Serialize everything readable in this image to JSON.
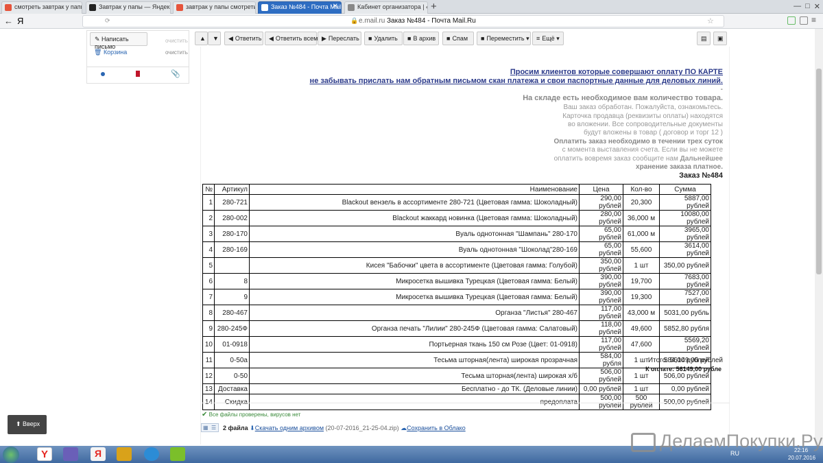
{
  "tabs": [
    {
      "label": "смотреть завтрак у папы н",
      "color": "#e6543c"
    },
    {
      "label": "Завтрак у папы — Яндекс.В",
      "color": "#222222"
    },
    {
      "label": "завтрак у папы смотреть о",
      "color": "#e6543c"
    },
    {
      "label": "Заказ №484 - Почта Mail",
      "color": "#1a5fb4"
    },
    {
      "label": "Кабинет организатора | «Д",
      "color": "#888888"
    }
  ],
  "window": {
    "minimize": "—",
    "restore": "□",
    "close": "✕",
    "new_tab": "+"
  },
  "addressbar": {
    "back": "←",
    "logo": "Я",
    "domain": "e.mail.ru",
    "title": "Заказ №484 - Почта Mail.Ru"
  },
  "sidebar": {
    "compose": "Написать письмо",
    "clear_top": "очистить",
    "trash": "Корзина",
    "clear": "очистить"
  },
  "toolbar": {
    "reply": "Ответить",
    "reply_all": "Ответить всем",
    "forward": "Переслать",
    "delete": "Удалить",
    "archive": "В архив",
    "spam": "Спам",
    "move": "Переместить",
    "more": "Ещё"
  },
  "letter": {
    "notice1": "Просим клиентов которые совершают оплату ПО КАРТЕ",
    "notice2": "не забывать прислать нам обратным письмом скан платежа и свои паспортные данные для деловых линий.",
    "dash": "-",
    "stock": "На складе есть необходимое вам количество товара.",
    "l1": "Ваш заказ обработан. Пожалуйста, ознакомьтесь.",
    "l2": "Карточка продавца (реквизиты оплаты) находятся",
    "l3": "во вложении. Все сопроводительные документы",
    "l4": "будут вложены в товар ( договор и торг 12 )",
    "l5": "Оплатить заказ необходимо в течении трех суток",
    "l6": "с момента выставления счета. Если вы не можете",
    "l7a": "оплатить вовремя заказ сообщите нам ",
    "l7b": "Дальнейшее",
    "l8": "хранение заказа платное.",
    "order_title": "Заказ №484",
    "headers": [
      "№",
      "Артикул",
      "Наименование",
      "Цена",
      "Кол-во",
      "Сумма"
    ],
    "rows": [
      [
        "1",
        "280-721",
        "Blackout вензель в ассортименте 280-721 (Цветовая гамма: Шоколадный)",
        "290,00 рублей",
        "20,300",
        "5887,00 рублей"
      ],
      [
        "2",
        "280-002",
        "Blackout жаккард новинка (Цветовая гамма: Шоколадный)",
        "280,00 рублей",
        "36,000 м",
        "10080,00 рублей"
      ],
      [
        "3",
        "280-170",
        "Вуаль однотонная \"Шампань\" 280-170",
        "65,00 рублей",
        "61,000 м",
        "3965,00 рублей"
      ],
      [
        "4",
        "280-169",
        "Вуаль однотонная \"Шоколад\"280-169",
        "65,00 рублей",
        "55,600",
        "3614,00 рублей"
      ],
      [
        "5",
        "",
        "Кисея \"Бабочки\" цвета в ассортименте (Цветовая гамма: Голубой)",
        "350,00 рублей",
        "1 шт",
        "350,00 рублей"
      ],
      [
        "6",
        "8",
        "Микросетка вышивка Турецкая (Цветовая гамма: Белый)",
        "390,00 рублей",
        "19,700",
        "7683,00 рублей"
      ],
      [
        "7",
        "9",
        "Микросетка вышивка Турецкая (Цветовая гамма: Белый)",
        "390,00 рублей",
        "19,300",
        "7527,00 рублей"
      ],
      [
        "8",
        "280-467",
        "Органза \"Листья\" 280-467",
        "117,00 рублей",
        "43,000 м",
        "5031,00 рубль"
      ],
      [
        "9",
        "280-245Ф",
        "Органза печать \"Лилии\" 280-245Ф (Цветовая гамма: Салатовый)",
        "118,00 рублей",
        "49,600",
        "5852,80 рубля"
      ],
      [
        "10",
        "01-0918",
        "Портьерная ткань 150 см Розе (Цвет: 01-0918)",
        "117,00 рублей",
        "47,600",
        "5569,20 рублей"
      ],
      [
        "11",
        "0-50а",
        "Тесьма шторная(лента) широкая прозрачная",
        "584,00 рубля",
        "1 шт",
        "584,00 рублей"
      ],
      [
        "12",
        "0-50",
        "Тесьма шторная(лента) широкая х/б",
        "506,00 рублей",
        "1 шт",
        "506,00 рублей"
      ],
      [
        "13",
        "Доставка",
        "Бесплатно - до ТК. (Деловые линии)",
        "0,00 рублей",
        "1 шт",
        "0,00 рублей"
      ],
      [
        "14",
        "Скидка",
        "предоплата",
        "500,00 рублей",
        "500 рублей",
        "500,00 рублей"
      ]
    ],
    "total": "Итого: 56149,00 рублей",
    "to_pay": "К оплате: 56149,00 рубле"
  },
  "attachments": {
    "virus_check": "Все файлы проверены, вирусов нет",
    "count": "2 файла",
    "download": "Скачать одним архивом",
    "archive_name": "(20-07-2016_21-25-04.zip)",
    "cloud": "Сохранить в Облако"
  },
  "up_button": "Вверх",
  "watermark": "ДелаемПокупки.Ру",
  "tray": {
    "lang": "RU",
    "time": "22:16",
    "date": "20.07.2016"
  }
}
